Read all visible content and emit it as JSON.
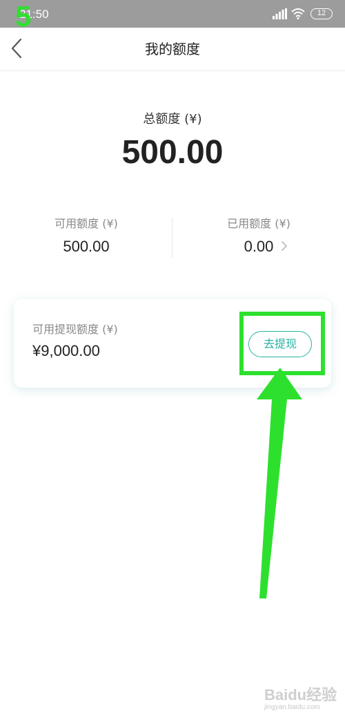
{
  "status_bar": {
    "time": "21:50",
    "battery": "12"
  },
  "annotation": {
    "step_number": "5"
  },
  "header": {
    "title": "我的额度"
  },
  "total": {
    "label": "总额度 (¥)",
    "value": "500.00"
  },
  "available": {
    "label": "可用额度 (¥)",
    "value": "500.00"
  },
  "used": {
    "label": "已用额度 (¥)",
    "value": "0.00"
  },
  "withdraw": {
    "label": "可用提现额度 (¥)",
    "value": "¥9,000.00",
    "button_label": "去提现"
  },
  "watermark": {
    "text": "Baidu经验",
    "url": "jingyan.baidu.com"
  },
  "colors": {
    "accent": "#26b3a3",
    "annotation_green": "#2ee02e"
  }
}
